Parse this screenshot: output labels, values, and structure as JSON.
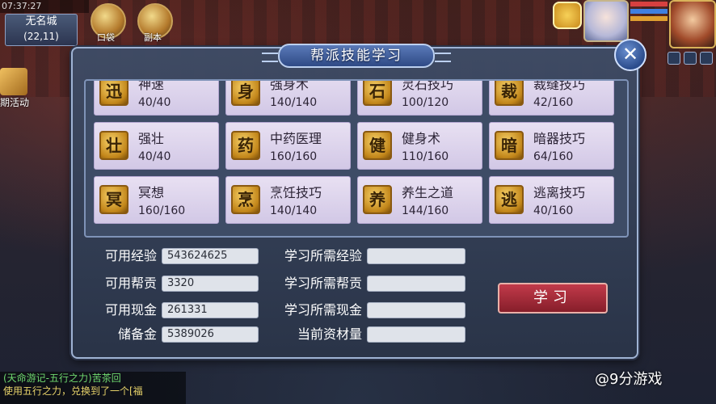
{
  "status": {
    "time": "07:37:27"
  },
  "location": {
    "name": "无名城",
    "coords": "(22,11)"
  },
  "hud": {
    "bag_label": "口袋",
    "dungeon_label": "副本",
    "event_label": "期活动"
  },
  "panel": {
    "title": "帮派技能学习",
    "close_glyph": "✕"
  },
  "skills": [
    {
      "name": "神速",
      "value": "40/40",
      "icon": "speed-icon",
      "glyph": "迅"
    },
    {
      "name": "强身术",
      "value": "140/140",
      "icon": "body-icon",
      "glyph": "身"
    },
    {
      "name": "灵石技巧",
      "value": "100/120",
      "icon": "stone-icon",
      "glyph": "石"
    },
    {
      "name": "裁缝技巧",
      "value": "42/160",
      "icon": "tailor-icon",
      "glyph": "裁"
    },
    {
      "name": "强壮",
      "value": "40/40",
      "icon": "strength-icon",
      "glyph": "壮"
    },
    {
      "name": "中药医理",
      "value": "160/160",
      "icon": "herb-icon",
      "glyph": "药"
    },
    {
      "name": "健身术",
      "value": "110/160",
      "icon": "fitness-icon",
      "glyph": "健"
    },
    {
      "name": "暗器技巧",
      "value": "64/160",
      "icon": "dart-icon",
      "glyph": "暗"
    },
    {
      "name": "冥想",
      "value": "160/160",
      "icon": "meditate-icon",
      "glyph": "冥"
    },
    {
      "name": "烹饪技巧",
      "value": "140/140",
      "icon": "cooking-icon",
      "glyph": "烹"
    },
    {
      "name": "养生之道",
      "value": "144/160",
      "icon": "health-icon",
      "glyph": "养"
    },
    {
      "name": "逃离技巧",
      "value": "40/160",
      "icon": "escape-icon",
      "glyph": "逃"
    }
  ],
  "resources": {
    "exp_label": "可用经验",
    "exp_value": "543624625",
    "contrib_label": "可用帮贡",
    "contrib_value": "3320",
    "cash_label": "可用现金",
    "cash_value": "261331",
    "reserve_label": "储备金",
    "reserve_value": "5389026"
  },
  "requirements": {
    "exp_label": "学习所需经验",
    "exp_value": "",
    "contrib_label": "学习所需帮贡",
    "contrib_value": "",
    "cash_label": "学习所需现金",
    "cash_value": "",
    "material_label": "当前资材量",
    "material_value": ""
  },
  "learn_button": "学习",
  "chat": {
    "line1": "(天命游记-五行之力)苦茶回",
    "line2": "使用五行之力，兑换到了一个[福"
  },
  "watermark": "@9分游戏",
  "colors": {
    "panel_bg": "#3e4c66",
    "skill_card": "#e0d8ee",
    "learn_button": "#a42a38",
    "chat_green": "#6fd86f",
    "chat_yellow": "#e8d36a"
  }
}
